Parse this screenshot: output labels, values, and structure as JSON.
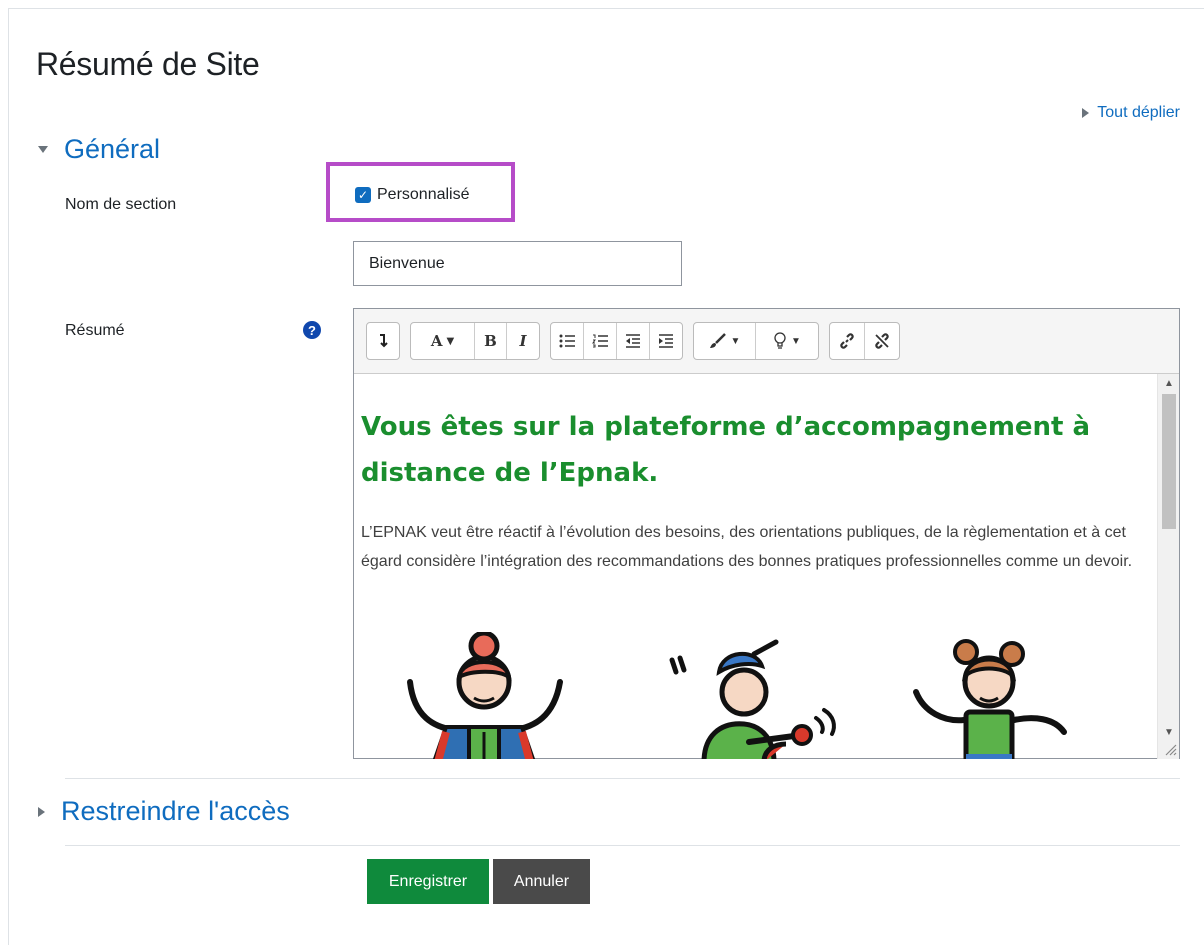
{
  "page": {
    "title": "Résumé de Site",
    "expand_all": "Tout déplier"
  },
  "general": {
    "heading": "Général",
    "section_name_label": "Nom de section",
    "custom_checkbox_label": "Personnalisé",
    "custom_checked": true,
    "section_name_value": "Bienvenue",
    "summary_label": "Résumé"
  },
  "editor": {
    "toolbar": [
      [
        "expand-icon",
        "font-style-icon",
        "bold-icon",
        "italic-icon"
      ],
      [
        "bullet-list-icon",
        "numbered-list-icon",
        "outdent-icon",
        "indent-icon"
      ],
      [
        "brush-icon",
        "bulb-icon"
      ],
      [
        "link-icon",
        "unlink-icon"
      ]
    ],
    "heading": "Vous êtes sur la plateforme d’accompagnement à distance de l’Epnak.",
    "paragraph": "L’EPNAK veut être réactif à l’évolution des besoins, des orientations publiques, de la règlementation et à cet égard considère l’intégration des recommandations des bonnes pratiques professionnelles comme un devoir.",
    "heading_color": "#1a8e2e"
  },
  "restrict": {
    "heading": "Restreindre l'accès"
  },
  "actions": {
    "save": "Enregistrer",
    "cancel": "Annuler"
  },
  "colors": {
    "link": "#0f6cbf",
    "save": "#0f8a3c",
    "cancel": "#4a4a4a",
    "highlight": "#b64cc8"
  }
}
